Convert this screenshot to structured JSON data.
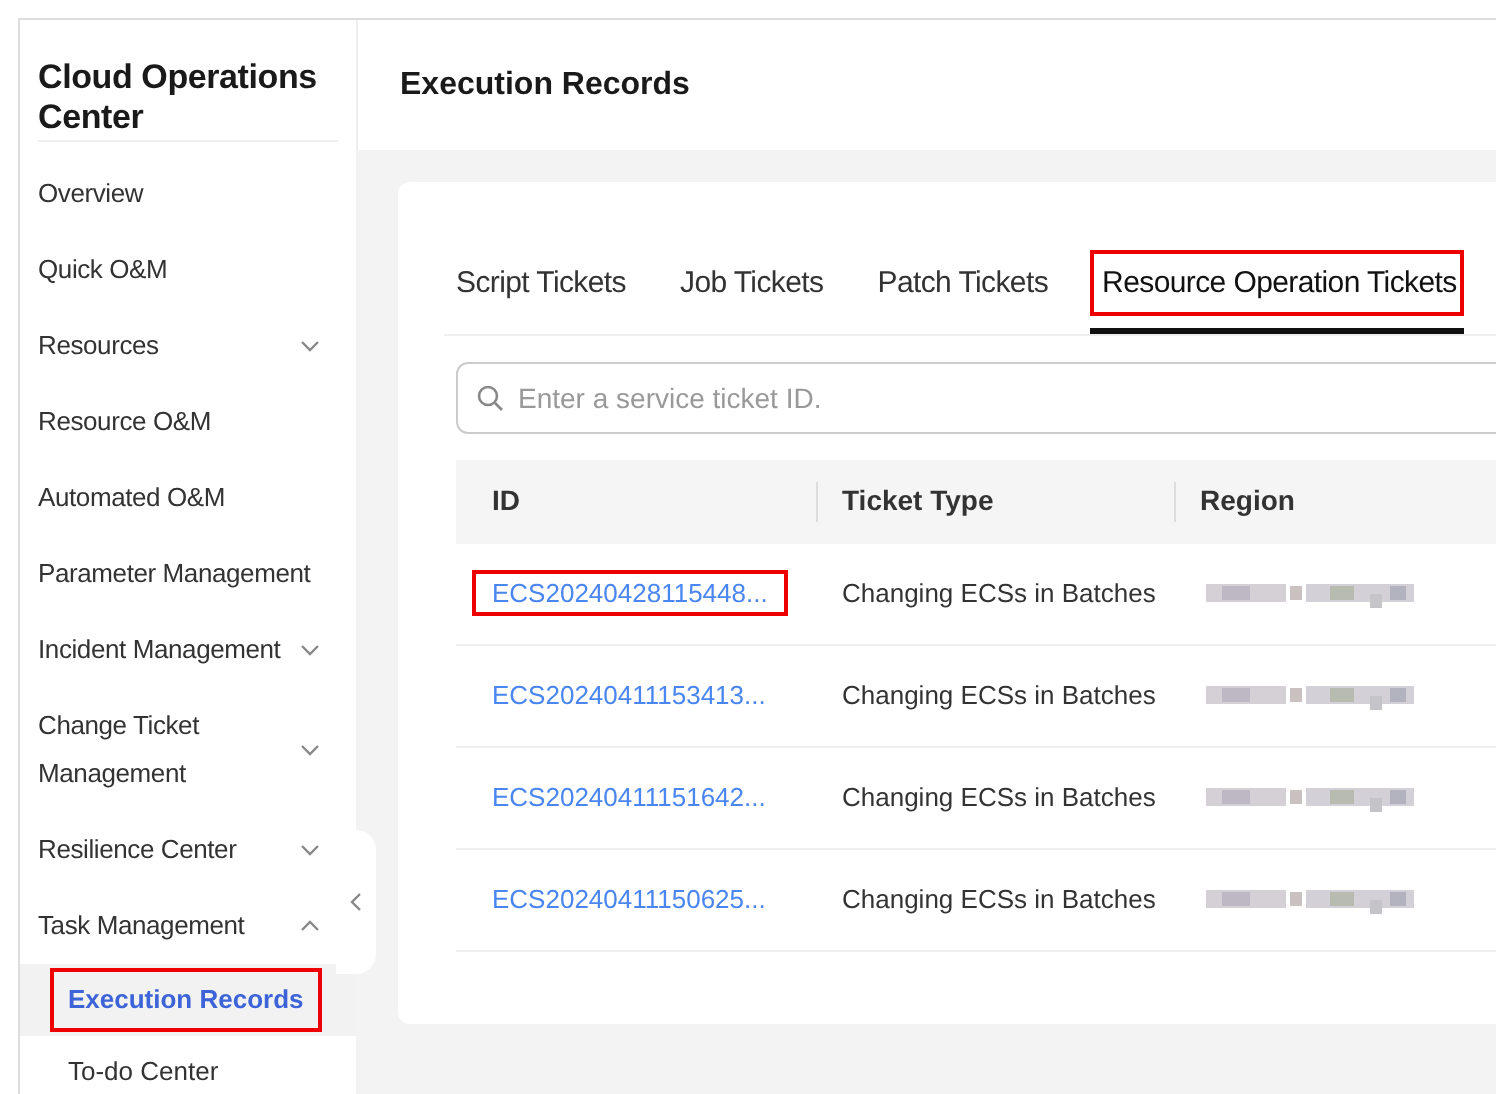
{
  "sidebar": {
    "title": "Cloud Operations Center",
    "items": [
      {
        "label": "Overview",
        "expandable": false
      },
      {
        "label": "Quick O&M",
        "expandable": false
      },
      {
        "label": "Resources",
        "expandable": true,
        "expanded": false
      },
      {
        "label": "Resource O&M",
        "expandable": false
      },
      {
        "label": "Automated O&M",
        "expandable": false
      },
      {
        "label": "Parameter Management",
        "expandable": false
      },
      {
        "label": "Incident Management",
        "expandable": true,
        "expanded": false
      },
      {
        "label": "Change Ticket Management",
        "expandable": true,
        "expanded": false
      },
      {
        "label": "Resilience Center",
        "expandable": true,
        "expanded": false
      },
      {
        "label": "Task Management",
        "expandable": true,
        "expanded": true,
        "children": [
          {
            "label": "Execution Records",
            "selected": true,
            "highlighted": true
          },
          {
            "label": "To-do Center",
            "selected": false,
            "highlighted": false
          }
        ]
      }
    ]
  },
  "header": {
    "title": "Execution Records"
  },
  "tabs": [
    {
      "label": "Script Tickets",
      "selected": false,
      "highlighted": false
    },
    {
      "label": "Job Tickets",
      "selected": false,
      "highlighted": false
    },
    {
      "label": "Patch Tickets",
      "selected": false,
      "highlighted": false
    },
    {
      "label": "Resource Operation Tickets",
      "selected": true,
      "highlighted": true
    }
  ],
  "search": {
    "placeholder": "Enter a service ticket ID."
  },
  "table": {
    "columns": [
      "ID",
      "Ticket Type",
      "Region"
    ],
    "rows": [
      {
        "id": "ECS20240428115448...",
        "ticket_type": "Changing ECSs in Batches",
        "highlighted": true
      },
      {
        "id": "ECS20240411153413...",
        "ticket_type": "Changing ECSs in Batches",
        "highlighted": false
      },
      {
        "id": "ECS20240411151642...",
        "ticket_type": "Changing ECSs in Batches",
        "highlighted": false
      },
      {
        "id": "ECS20240411150625...",
        "ticket_type": "Changing ECSs in Batches",
        "highlighted": false
      }
    ]
  }
}
